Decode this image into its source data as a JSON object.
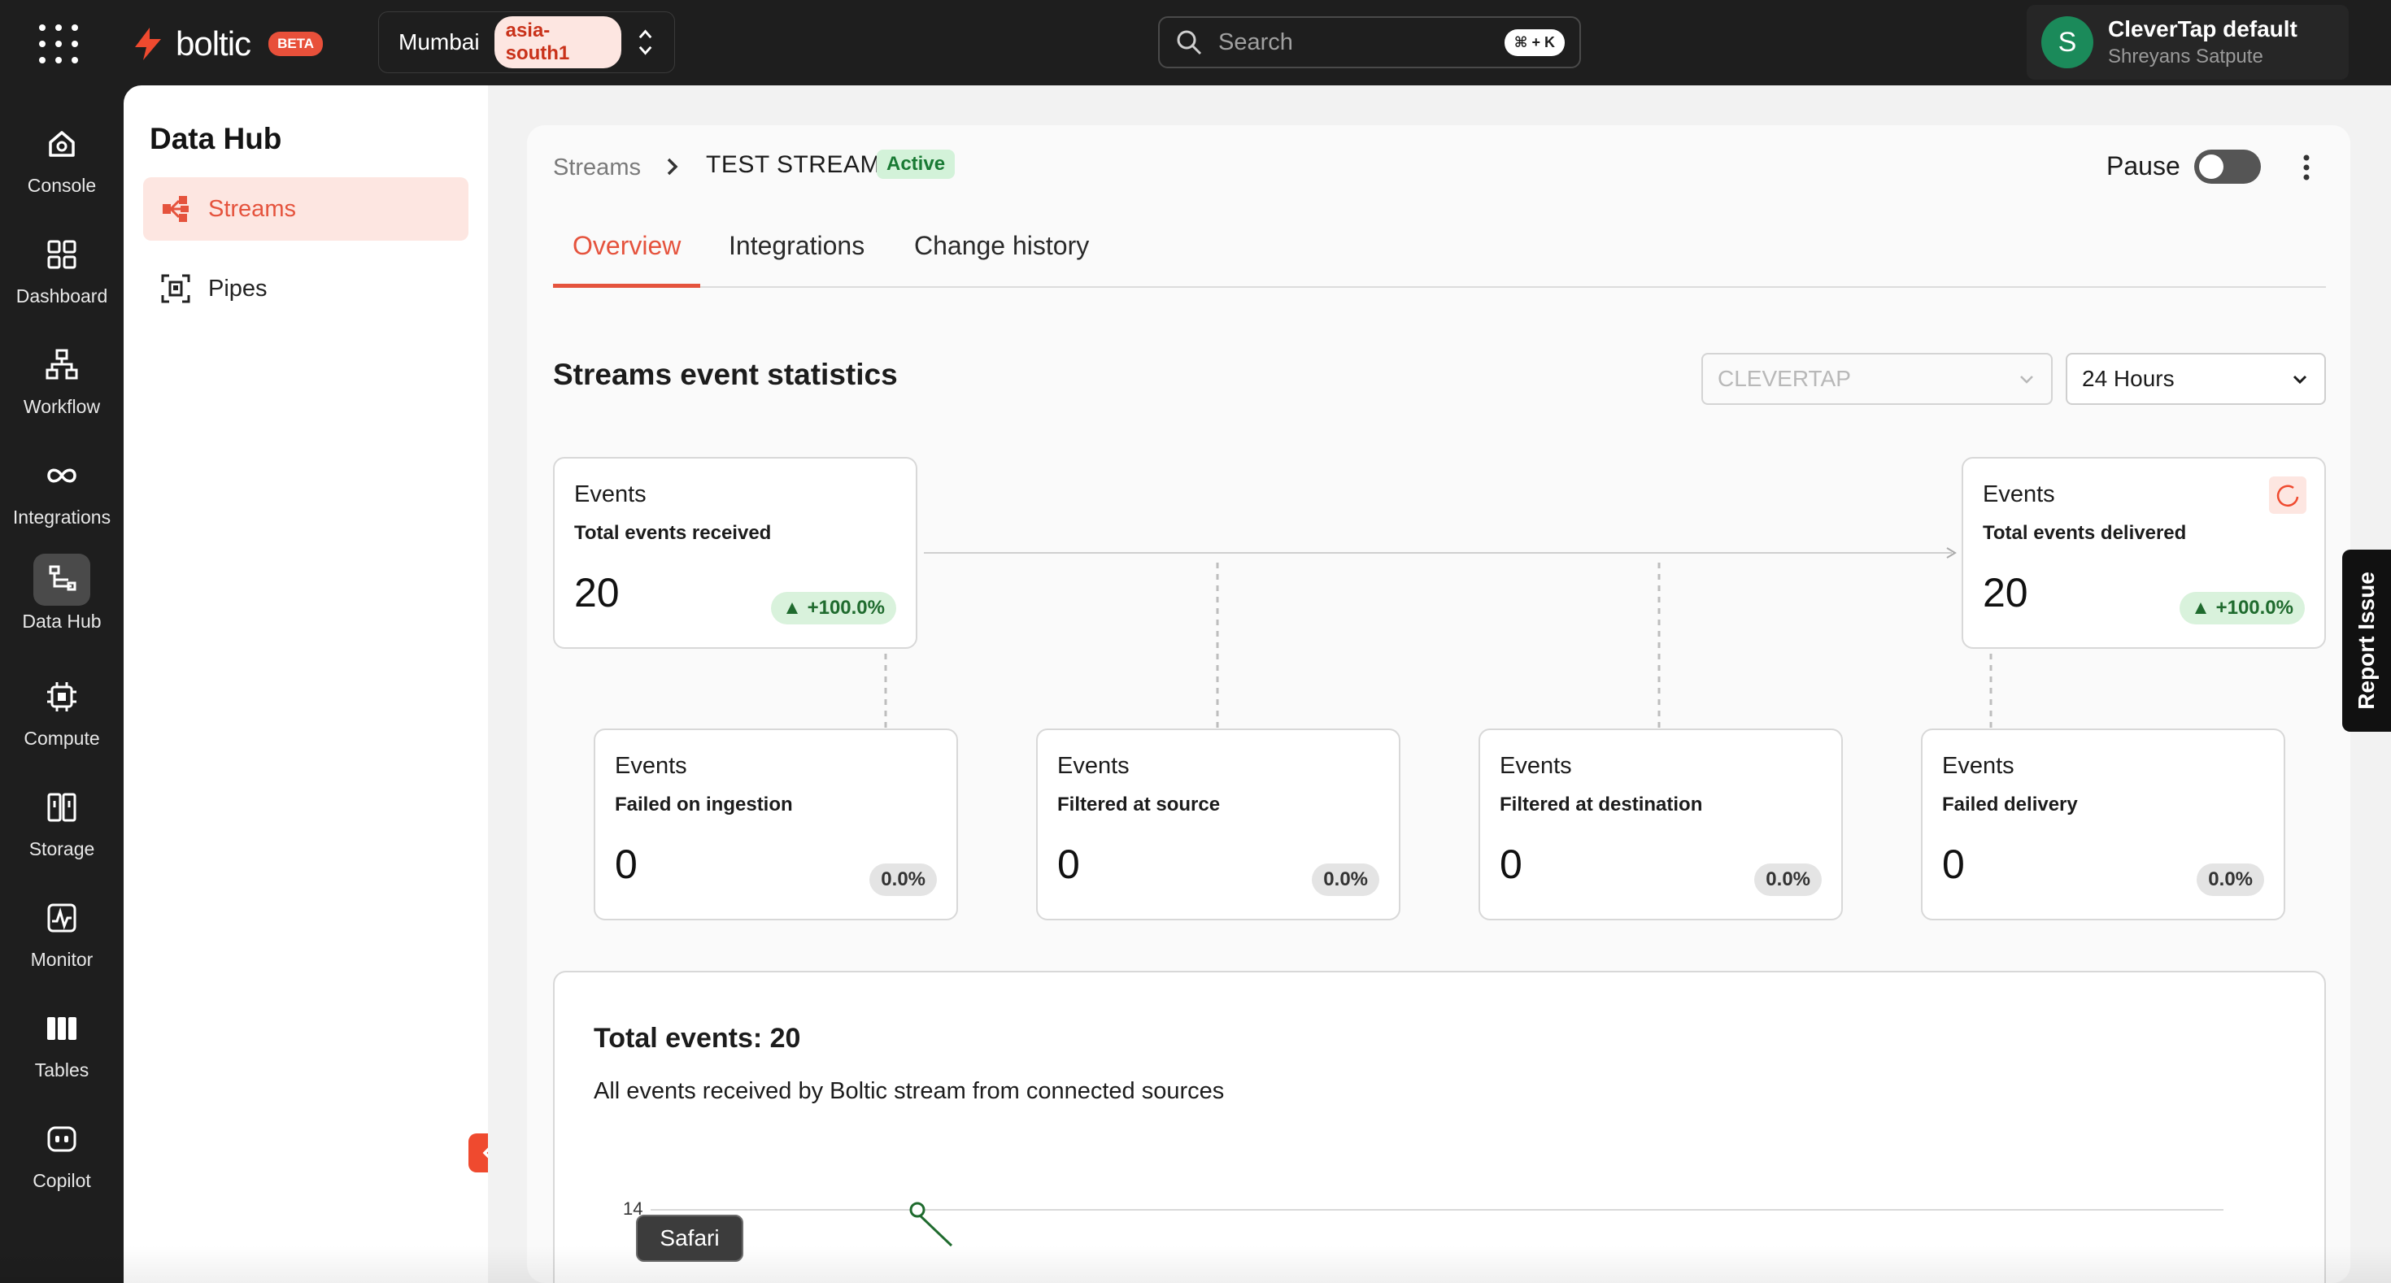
{
  "brand": {
    "name": "boltic",
    "badge": "BETA",
    "accent": "#e5533d"
  },
  "region": {
    "name": "Mumbai",
    "code": "asia-south1"
  },
  "search": {
    "placeholder": "Search",
    "shortcut": "⌘ + K"
  },
  "account": {
    "initial": "S",
    "org": "CleverTap default",
    "user": "Shreyans Satpute",
    "avatar_color": "#1b8a5a"
  },
  "rail": [
    {
      "label": "Console",
      "icon": "home-icon"
    },
    {
      "label": "Dashboard",
      "icon": "grid-icon"
    },
    {
      "label": "Workflow",
      "icon": "workflow-icon"
    },
    {
      "label": "Integrations",
      "icon": "infinity-icon"
    },
    {
      "label": "Data Hub",
      "icon": "data-hub-icon",
      "active": true
    },
    {
      "label": "Compute",
      "icon": "chip-icon"
    },
    {
      "label": "Storage",
      "icon": "storage-icon"
    },
    {
      "label": "Monitor",
      "icon": "pulse-icon"
    },
    {
      "label": "Tables",
      "icon": "tables-icon"
    },
    {
      "label": "Copilot",
      "icon": "copilot-icon"
    }
  ],
  "hub": {
    "title": "Data Hub",
    "items": [
      {
        "label": "Streams",
        "icon": "streams-icon",
        "active": true
      },
      {
        "label": "Pipes",
        "icon": "pipes-icon"
      }
    ]
  },
  "header": {
    "breadcrumb_root": "Streams",
    "stream_name": "TEST STREAM",
    "status": "Active",
    "pause_label": "Pause",
    "pause_on": false
  },
  "tabs": [
    {
      "label": "Overview",
      "active": true
    },
    {
      "label": "Integrations"
    },
    {
      "label": "Change history"
    }
  ],
  "stats": {
    "title": "Streams event statistics",
    "source": "CLEVERTAP",
    "range": "24 Hours",
    "received": {
      "kind": "Events",
      "desc": "Total events received",
      "value": "20",
      "change": "+100.0%"
    },
    "delivered": {
      "kind": "Events",
      "desc": "Total events delivered",
      "value": "20",
      "change": "+100.0%"
    },
    "failed_ingestion": {
      "kind": "Events",
      "desc": "Failed on ingestion",
      "value": "0",
      "change": "0.0%"
    },
    "filtered_source": {
      "kind": "Events",
      "desc": "Filtered at source",
      "value": "0",
      "change": "0.0%"
    },
    "filtered_destination": {
      "kind": "Events",
      "desc": "Filtered at destination",
      "value": "0",
      "change": "0.0%"
    },
    "failed_delivery": {
      "kind": "Events",
      "desc": "Failed delivery",
      "value": "0",
      "change": "0.0%"
    }
  },
  "total": {
    "title": "Total events: 20",
    "subtitle": "All events received by Boltic stream from connected sources",
    "y_tick": "14"
  },
  "report_issue": "Report Issue",
  "dock_tooltip": "Safari"
}
